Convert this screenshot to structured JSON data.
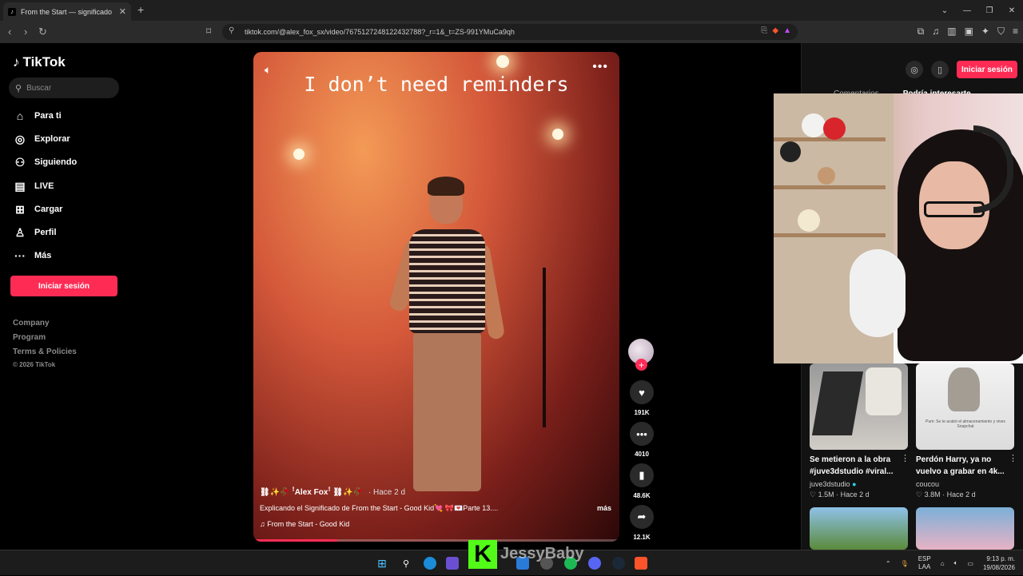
{
  "browser": {
    "tab_title": "From the Start — significado",
    "url": "tiktok.com/@alex_fox_sx/video/7675127248122432788?_r=1&_t=ZS-991YMuCa9qh"
  },
  "sidebar": {
    "brand": "TikTok",
    "search_placeholder": "Buscar",
    "items": [
      {
        "label": "Para ti",
        "icon": "home-icon"
      },
      {
        "label": "Explorar",
        "icon": "compass-icon"
      },
      {
        "label": "Siguiendo",
        "icon": "user-follow-icon"
      },
      {
        "label": "LIVE",
        "icon": "live-icon"
      },
      {
        "label": "Cargar",
        "icon": "upload-icon"
      },
      {
        "label": "Perfil",
        "icon": "profile-icon"
      },
      {
        "label": "Más",
        "icon": "more-dots-icon"
      }
    ],
    "login_label": "Iniciar sesión",
    "footer": [
      "Company",
      "Program",
      "Terms & Policies"
    ],
    "copyright": "© 2026 TikTok"
  },
  "video": {
    "caption_overlay": "I don’t need reminders",
    "author": "⛓✨🥀 ꜝAlex Foxꜝ ⛓✨🥀",
    "posted_ago": "· Hace 2 d",
    "description": "Explicando el Significado de From the Start - Good Kid💘 🎀💌Parte 13....",
    "more_label": "más",
    "music": "♫ From the Start - Good Kid",
    "progress": 0.23
  },
  "actions": {
    "likes": "191K",
    "comments": "4010",
    "saves": "48.6K",
    "shares": "12.1K"
  },
  "right_panel": {
    "login_label": "Iniciar sesión",
    "tabs": [
      "Comentarios",
      "Podría interesarte"
    ],
    "videos": [
      {
        "title": "Se metieron a la obra #juve3dstudio #viral...",
        "author": "juve3dstudio",
        "views": "1.5M",
        "ago": "Hace 2 d"
      },
      {
        "title": "Perdón Harry, ya no vuelvo a grabar en 4k...",
        "author": "coucou",
        "views": "3.8M",
        "ago": "Hace 2 d"
      }
    ],
    "thumb2_text": "Pum: Se te acabó el almacenamiento y vives Snapchat"
  },
  "stream": {
    "streamer_name": "JessyBaby",
    "platform_letter": "K"
  },
  "taskbar": {
    "lang": "ESP",
    "lang2": "LAA",
    "time": "9:13 p. m.",
    "date": "19/08/2026"
  },
  "colors": {
    "accent": "#fe2c55",
    "kick_green": "#53fc18"
  }
}
